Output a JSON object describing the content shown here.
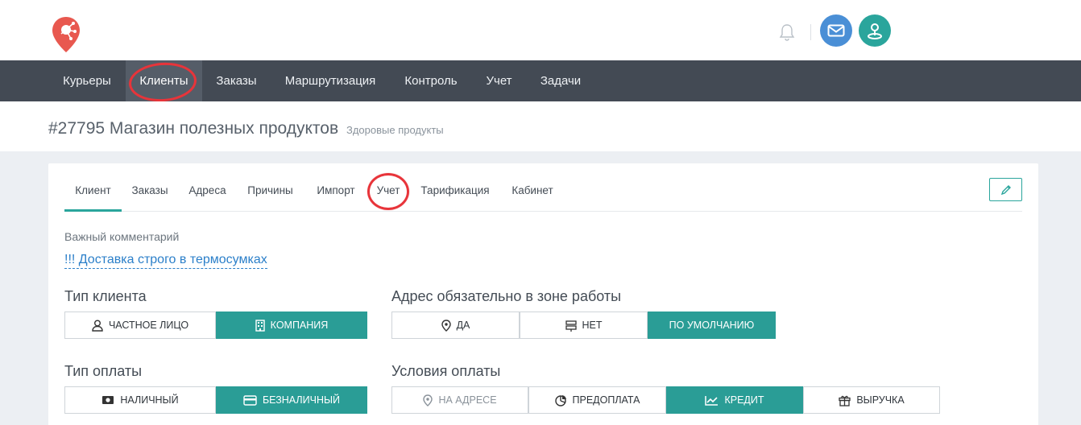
{
  "header": {
    "notification_icon": "bell-icon",
    "mail_icon": "envelope-icon",
    "location_icon": "map-pin-icon",
    "colors": {
      "mail": "#4a8fd6",
      "location": "#2aa59c",
      "logo": "#e8584f"
    }
  },
  "nav": {
    "items": [
      {
        "label": "Курьеры"
      },
      {
        "label": "Клиенты",
        "active": true
      },
      {
        "label": "Заказы"
      },
      {
        "label": "Маршрутизация"
      },
      {
        "label": "Контроль"
      },
      {
        "label": "Учет"
      },
      {
        "label": "Задачи"
      }
    ]
  },
  "page": {
    "title": "#27795 Магазин полезных продуктов",
    "subtitle": "Здоровые продукты"
  },
  "tabs": {
    "items": [
      {
        "label": "Клиент",
        "active": true
      },
      {
        "label": "Заказы"
      },
      {
        "label": "Адреса"
      },
      {
        "label": "Причины"
      },
      {
        "label": "Импорт"
      },
      {
        "label": "Учет"
      },
      {
        "label": "Тарификация"
      },
      {
        "label": "Кабинет"
      }
    ],
    "edit_icon": "pencil-icon"
  },
  "form": {
    "comment_label": "Важный комментарий",
    "comment_value": "!!! Доставка строго в термосумках",
    "client_type": {
      "label": "Тип клиента",
      "options": [
        {
          "label": "ЧАСТНОЕ ЛИЦО",
          "icon": "person-icon"
        },
        {
          "label": "КОМПАНИЯ",
          "icon": "building-icon",
          "selected": true
        }
      ]
    },
    "address_zone": {
      "label": "Адрес обязательно в зоне работы",
      "options": [
        {
          "label": "ДА",
          "icon": "map-marker-icon"
        },
        {
          "label": "НЕТ",
          "icon": "signpost-icon"
        },
        {
          "label": "ПО УМОЛЧАНИЮ",
          "selected": true
        }
      ]
    },
    "payment_type": {
      "label": "Тип оплаты",
      "options": [
        {
          "label": "НАЛИЧНЫЙ",
          "icon": "cash-icon"
        },
        {
          "label": "БЕЗНАЛИЧНЫЙ",
          "icon": "credit-card-icon",
          "selected": true
        }
      ]
    },
    "payment_terms": {
      "label": "Условия оплаты",
      "options": [
        {
          "label": "НА АДРЕСЕ",
          "icon": "map-marker-icon",
          "disabled": true
        },
        {
          "label": "ПРЕДОПЛАТА",
          "icon": "pie-chart-icon"
        },
        {
          "label": "КРЕДИТ",
          "icon": "trend-chart-icon",
          "selected": true
        },
        {
          "label": "ВЫРУЧКА",
          "icon": "gift-icon"
        }
      ]
    }
  }
}
